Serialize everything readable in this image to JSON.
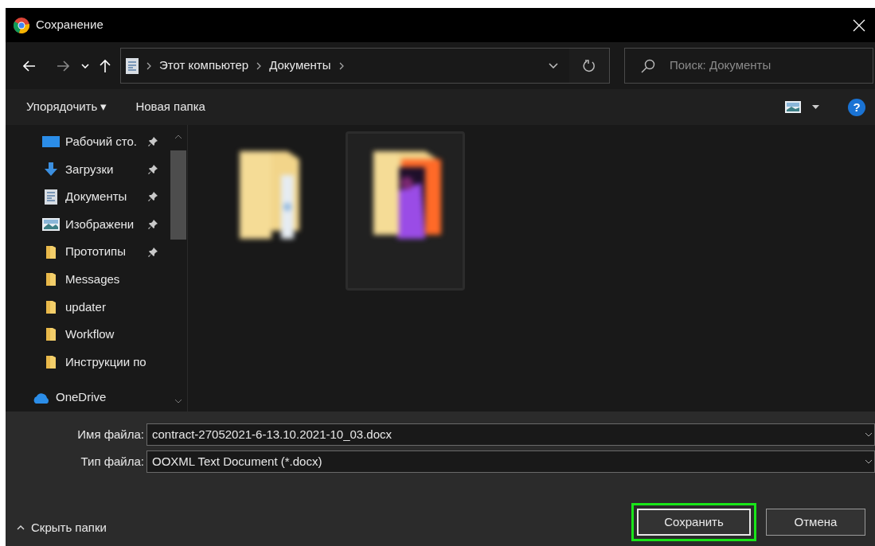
{
  "window": {
    "title": "Сохранение"
  },
  "address": {
    "segments": [
      "Этот компьютер",
      "Документы"
    ]
  },
  "search": {
    "placeholder": "Поиск: Документы"
  },
  "toolbar": {
    "organize": "Упорядочить ▾",
    "new_folder": "Новая папка",
    "help": "?"
  },
  "sidebar": {
    "items": [
      {
        "label": "Рабочий сто.",
        "kind": "desktop",
        "pinned": true
      },
      {
        "label": "Загрузки",
        "kind": "download",
        "pinned": true
      },
      {
        "label": "Документы",
        "kind": "document",
        "pinned": true
      },
      {
        "label": "Изображени",
        "kind": "image",
        "pinned": true
      },
      {
        "label": "Прототипы",
        "kind": "folder",
        "pinned": true
      },
      {
        "label": "Messages",
        "kind": "folder",
        "pinned": false
      },
      {
        "label": "updater",
        "kind": "folder",
        "pinned": false
      },
      {
        "label": "Workflow",
        "kind": "folder",
        "pinned": false
      },
      {
        "label": "Инструкции по",
        "kind": "folder",
        "pinned": false
      },
      {
        "label": "OneDrive",
        "kind": "cloud",
        "pinned": false
      }
    ]
  },
  "files": [
    {
      "kind": "folder",
      "selected": false
    },
    {
      "kind": "folder-media",
      "selected": true
    }
  ],
  "form": {
    "filename_label": "Имя файла:",
    "filename": "contract-27052021-6-13.10.2021-10_03.docx",
    "type_label": "Тип файла:",
    "type": "OOXML Text Document (*.docx)"
  },
  "footer": {
    "hide_folders": "Скрыть папки",
    "save": "Сохранить",
    "save_highlighted": true,
    "cancel": "Отмена"
  }
}
